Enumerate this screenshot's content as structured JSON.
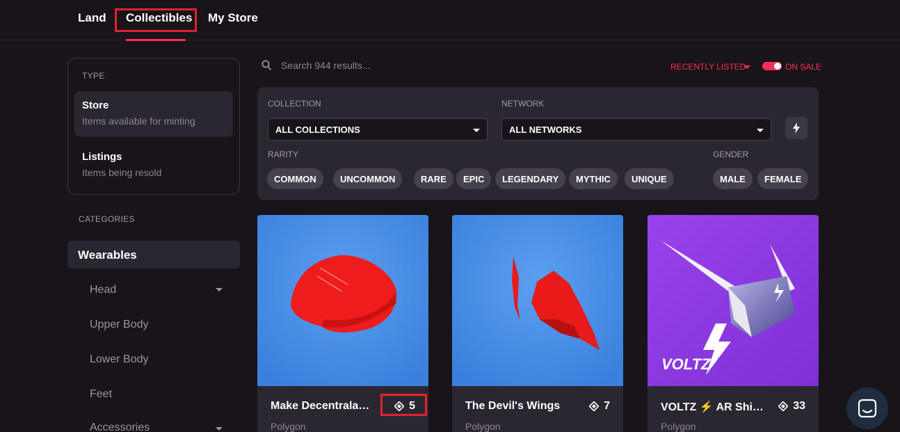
{
  "nav": {
    "tabs": [
      "Land",
      "Collectibles",
      "My Store"
    ],
    "active": "Collectibles"
  },
  "sidebar": {
    "type_label": "TYPE",
    "types": [
      {
        "title": "Store",
        "subtitle": "Items available for minting"
      },
      {
        "title": "Listings",
        "subtitle": "Items being resold"
      }
    ],
    "categories_label": "CATEGORIES",
    "active_category": "Wearables",
    "categories": [
      "Head",
      "Upper Body",
      "Lower Body",
      "Feet",
      "Accessories"
    ]
  },
  "search": {
    "placeholder": "Search 944 results..."
  },
  "sort": {
    "label": "RECENTLY LISTED",
    "on_sale_label": "ON SALE",
    "on_sale": true
  },
  "filters": {
    "collection_label": "COLLECTION",
    "collection_value": "ALL COLLECTIONS",
    "network_label": "NETWORK",
    "network_value": "ALL NETWORKS",
    "rarity_label": "RARITY",
    "rarities": [
      "COMMON",
      "UNCOMMON",
      "RARE",
      "EPIC",
      "LEGENDARY",
      "MYTHIC",
      "UNIQUE"
    ],
    "gender_label": "GENDER",
    "genders": [
      "MALE",
      "FEMALE"
    ]
  },
  "cards": [
    {
      "name": "Make Decentraland Great Again",
      "price": "5",
      "network": "Polygon",
      "bg": "#4a90e2",
      "icon": "red-cap"
    },
    {
      "name": "The Devil's Wings",
      "price": "7",
      "network": "Polygon",
      "bg": "#4a90e2",
      "icon": "red-wings"
    },
    {
      "name": "VOLTZ ⚡ AR Shield",
      "price": "33",
      "network": "Polygon",
      "bg": "#8e3ce0",
      "icon": "voltz-shield",
      "logo": "VOLTZ"
    }
  ],
  "colors": {
    "accent": "#ff2d55",
    "background": "#18141a",
    "panel": "#2b2730",
    "highlight_box": "#e0232f"
  }
}
